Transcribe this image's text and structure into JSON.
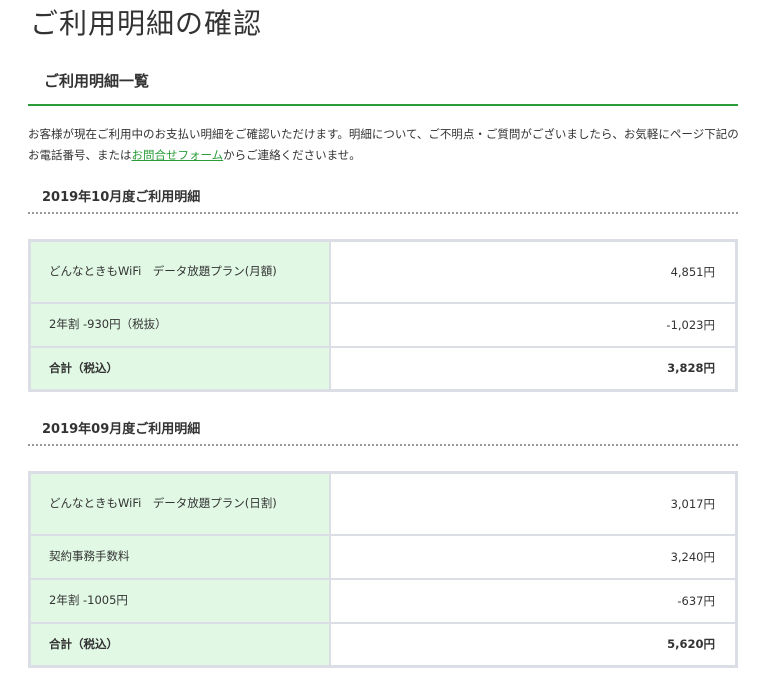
{
  "page": {
    "title": "ご利用明細の確認"
  },
  "section": {
    "title": "ご利用明細一覧"
  },
  "intro": {
    "text_before": "お客様が現在ご利用中のお支払い明細をご確認いただけます。明細について、ご不明点・ご質問がございましたら、お気軽にページ下記のお電話番号、または",
    "link_label": "お問合せフォーム",
    "text_after": "からご連絡くださいませ。"
  },
  "statements": [
    {
      "title": "2019年10月度ご利用明細",
      "rows": [
        {
          "label": "どんなときもWiFi　データ放題プラン(月額)",
          "amount": "4,851円"
        },
        {
          "label": "2年割 -930円（税抜）",
          "amount": "-1,023円"
        }
      ],
      "total": {
        "label": "合計（税込）",
        "amount": "3,828円"
      }
    },
    {
      "title": "2019年09月度ご利用明細",
      "rows": [
        {
          "label": "どんなときもWiFi　データ放題プラン(日割)",
          "amount": "3,017円"
        },
        {
          "label": "契約事務手数料",
          "amount": "3,240円"
        },
        {
          "label": "2年割 -1005円",
          "amount": "-637円"
        }
      ],
      "total": {
        "label": "合計（税込）",
        "amount": "5,620円"
      }
    }
  ],
  "colors": {
    "accent_green": "#2a9d3a",
    "label_cell_bg": "#e0f8e4",
    "table_border": "#dcdee6"
  }
}
